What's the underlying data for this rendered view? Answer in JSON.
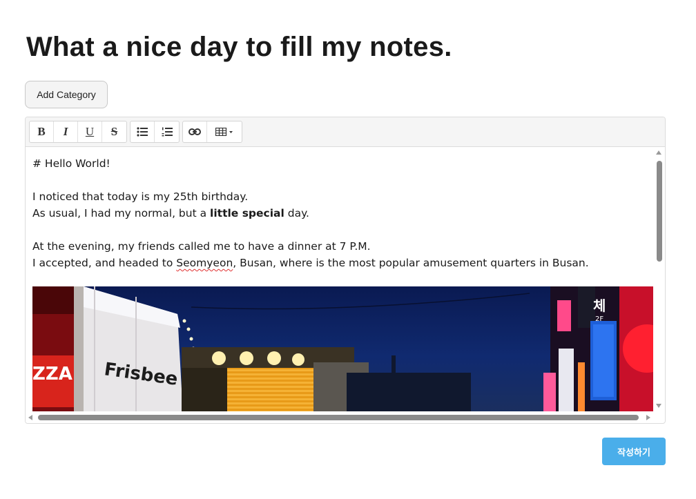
{
  "page": {
    "title": "What a nice day to fill my notes."
  },
  "actions": {
    "add_category": "Add Category",
    "submit": "작성하기"
  },
  "toolbar": {
    "bold": "B",
    "italic": "I",
    "underline": "U",
    "strike": "S",
    "icons": [
      "bold-icon",
      "italic-icon",
      "underline-icon",
      "strikethrough-icon",
      "bullet-list-icon",
      "numbered-list-icon",
      "link-icon",
      "table-icon"
    ]
  },
  "editor": {
    "heading": "# Hello World!",
    "line1": "I noticed that today is my 25th birthday.",
    "line2_pre": "As usual, I had my normal, but a ",
    "line2_bold": "little special",
    "line2_post": " day.",
    "line3": "At the evening, my friends called me to have a dinner at 7 P.M.",
    "line4_pre": "I accepted, and headed to ",
    "line4_misspelled": "Seomyeon",
    "line4_post": ", Busan, where is the most popular amusement quarters in Busan."
  },
  "photo": {
    "description_icon": "image-icon",
    "signs": [
      "Frisbee",
      "2F",
      "체",
      "ZZA"
    ]
  },
  "colors": {
    "accent": "#4aaeea",
    "photo_sky": "#0a1a52"
  }
}
